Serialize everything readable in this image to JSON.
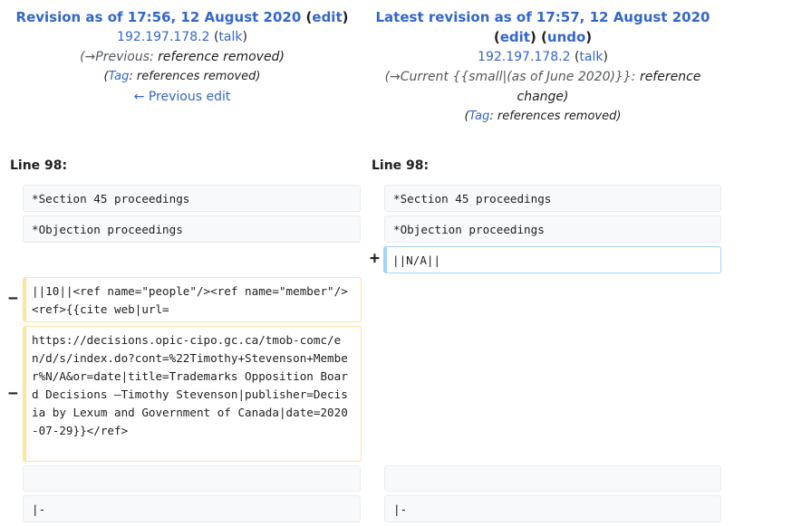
{
  "left_header": {
    "title_prefix": "Revision as of 17:56, 12 August 2020",
    "edit_label": "edit",
    "user": "192.197.178.2",
    "talk_label": "talk",
    "summary_arrow": "(→Previous:",
    "summary_text": "reference removed)",
    "tag_label": "Tag",
    "tag_value": ": references removed)",
    "prev_edit_label": "← Previous edit"
  },
  "right_header": {
    "title": "Latest revision as of 17:57, 12 August 2020",
    "edit_label": "edit",
    "undo_label": "undo",
    "user": "192.197.178.2",
    "talk_label": "talk",
    "summary_arrow": "(→Current {{small|(as of June 2020)}}:",
    "summary_text": "reference",
    "summary_text2": "change)",
    "tag_label": "Tag",
    "tag_value": ": references removed)"
  },
  "diff": {
    "left_line_label": "Line 98:",
    "right_line_label": "Line 98:",
    "context1": "*Section 45 proceedings",
    "context2": "*Objection proceedings",
    "added": "||N/A||",
    "removed1": "||10||<ref name=\"people\"/><ref name=\"member\"/><ref>{{cite web|url=",
    "removed2": "https://decisions.opic-cipo.gc.ca/tmob-comc/en/d/s/index.do?cont=%22Timothy+Stevenson+Member%N/A&or=date|title=Trademarks Opposition Board Decisions –Timothy Stevenson|publisher=Decisia by Lexum and Government of Canada|date=2020-07-29}}</ref>",
    "context4": "|-",
    "minus": "−",
    "plus": "+"
  }
}
